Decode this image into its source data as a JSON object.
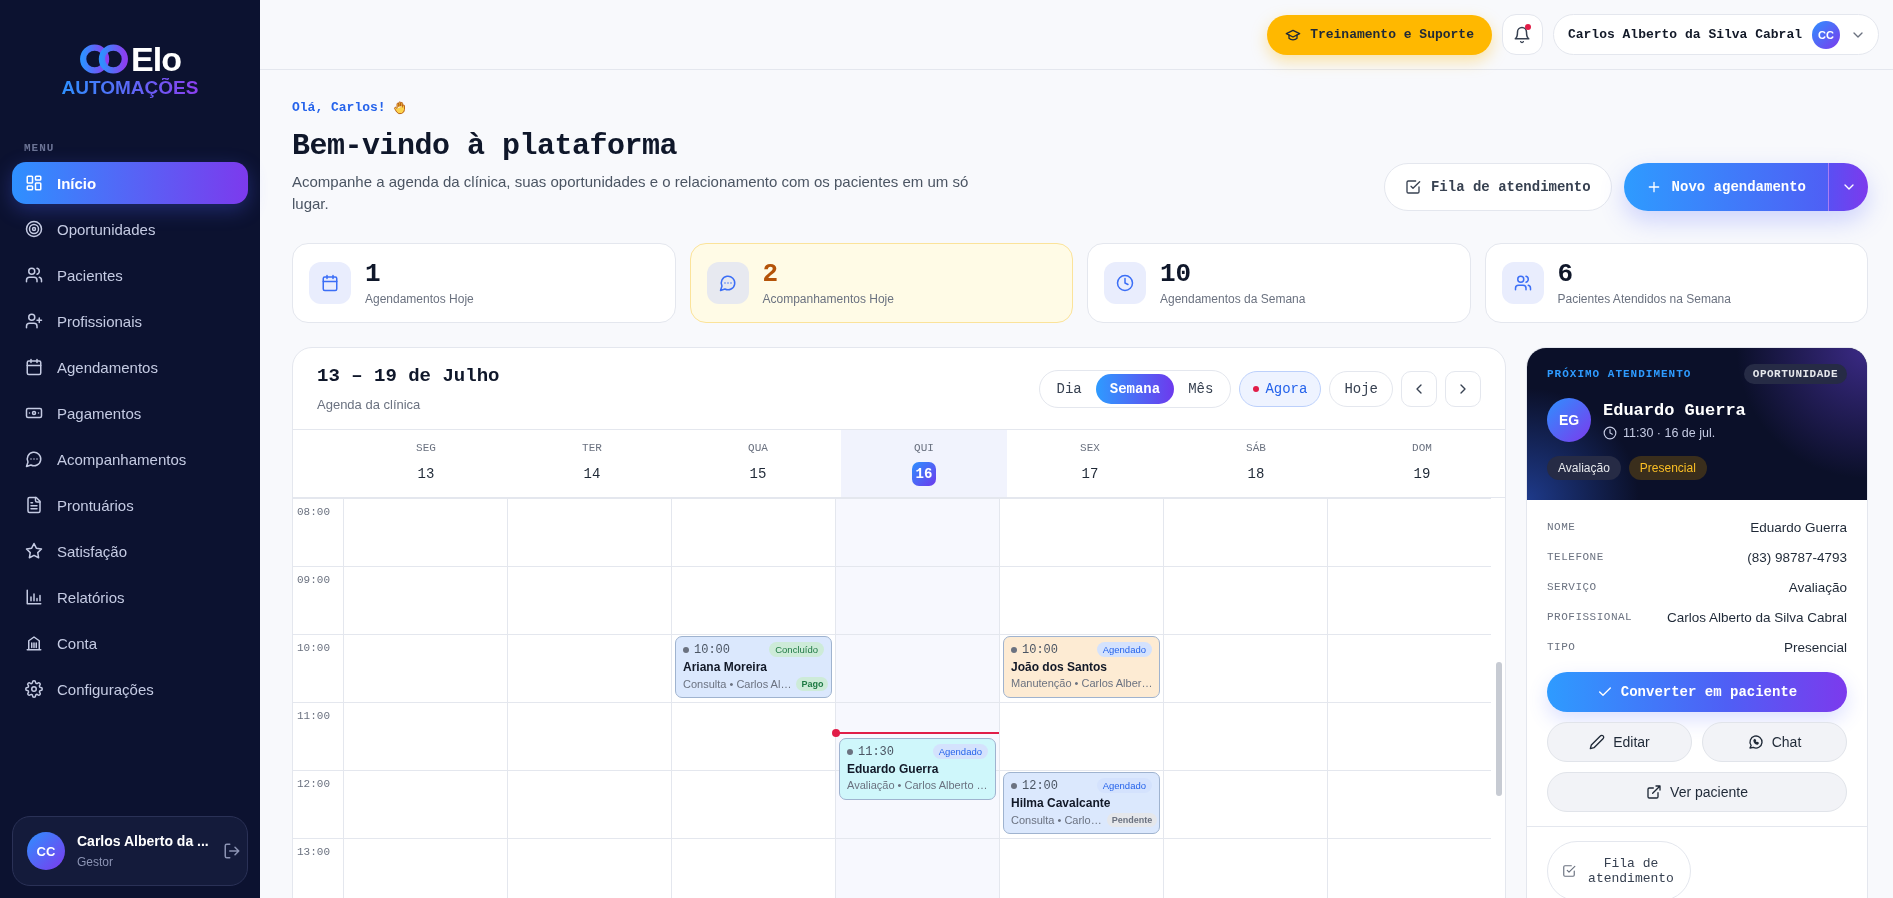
{
  "sidebar": {
    "logo": {
      "name": "Elo",
      "tagline": "AUTOMAÇÕES"
    },
    "menu_label": "MENU",
    "items": [
      {
        "label": "Início",
        "selected": true
      },
      {
        "label": "Oportunidades",
        "selected": false
      },
      {
        "label": "Pacientes",
        "selected": false
      },
      {
        "label": "Profissionais",
        "selected": false
      },
      {
        "label": "Agendamentos",
        "selected": false
      },
      {
        "label": "Pagamentos",
        "selected": false
      },
      {
        "label": "Acompanhamentos",
        "selected": false
      },
      {
        "label": "Prontuários",
        "selected": false
      },
      {
        "label": "Satisfação",
        "selected": false
      },
      {
        "label": "Relatórios",
        "selected": false
      },
      {
        "label": "Conta",
        "selected": false
      },
      {
        "label": "Configurações",
        "selected": false
      }
    ],
    "user": {
      "initials": "CC",
      "name": "Carlos Alberto da ...",
      "role": "Gestor"
    }
  },
  "header": {
    "support_button": "Treinamento e Suporte",
    "notifications": {
      "unread": true
    },
    "user": {
      "name": "Carlos Alberto da Silva Cabral",
      "initials": "CC"
    }
  },
  "welcome": {
    "greeting": "Olá, Carlos!",
    "title": "Bem-vindo à plataforma",
    "subtitle": "Acompanhe a agenda da clínica, suas oportunidades e o relacionamento com os pacientes em um só lugar.",
    "queue_button": "Fila de atendimento",
    "new_button": "Novo agendamento"
  },
  "stats": [
    {
      "value": "1",
      "label": "Agendamentos Hoje",
      "highlighted": false
    },
    {
      "value": "2",
      "label": "Acompanhamentos Hoje",
      "highlighted": true
    },
    {
      "value": "10",
      "label": "Agendamentos da Semana",
      "highlighted": false
    },
    {
      "value": "6",
      "label": "Pacientes Atendidos na Semana",
      "highlighted": false
    }
  ],
  "calendar": {
    "title": "13 – 19 de Julho",
    "subtitle": "Agenda da clínica",
    "views": [
      {
        "label": "Dia",
        "selected": false
      },
      {
        "label": "Semana",
        "selected": true
      },
      {
        "label": "Mês",
        "selected": false
      }
    ],
    "now_button": "Agora",
    "today_button": "Hoje",
    "hours": [
      "08:00",
      "09:00",
      "10:00",
      "11:00",
      "12:00",
      "13:00"
    ],
    "days": [
      {
        "name": "SEG",
        "date": "13",
        "today": false
      },
      {
        "name": "TER",
        "date": "14",
        "today": false
      },
      {
        "name": "QUA",
        "date": "15",
        "today": false,
        "events": [
          {
            "time": "10:00",
            "name": "Ariana Moreira",
            "detail": "Consulta • Carlos Al…",
            "color": "#dbe8fd",
            "status": {
              "label": "Concluído",
              "kind": "done"
            },
            "payment": {
              "label": "Pago",
              "kind": "paid"
            }
          }
        ]
      },
      {
        "name": "QUI",
        "date": "16",
        "today": true,
        "events": [
          {
            "time": "11:30",
            "name": "Eduardo Guerra",
            "detail": "Avaliação • Carlos Alberto …",
            "color": "#cff7fb",
            "status": {
              "label": "Agendado",
              "kind": "scheduled"
            }
          }
        ]
      },
      {
        "name": "SEX",
        "date": "17",
        "today": false,
        "events": [
          {
            "time": "10:00",
            "name": "João dos Santos",
            "detail": "Manutenção • Carlos Alber…",
            "color": "#fdebd3",
            "status": {
              "label": "Agendado",
              "kind": "scheduled"
            }
          },
          {
            "time": "12:00",
            "name": "Hilma Cavalcante",
            "detail": "Consulta • Carlo…",
            "color": "#dbe8fd",
            "status": {
              "label": "Agendado",
              "kind": "scheduled"
            },
            "payment": {
              "label": "Pendente",
              "kind": "pending"
            }
          }
        ]
      },
      {
        "name": "SÁB",
        "date": "18",
        "today": false
      },
      {
        "name": "DOM",
        "date": "19",
        "today": false
      }
    ]
  },
  "next_appointment": {
    "heading": "PRÓXIMO ATENDIMENTO",
    "badge": "OPORTUNIDADE",
    "initials": "EG",
    "name": "Eduardo Guerra",
    "when": "11:30 · 16 de jul.",
    "tags": [
      {
        "label": "Avaliação",
        "kind": "neutral"
      },
      {
        "label": "Presencial",
        "kind": "accent"
      }
    ],
    "details": [
      {
        "label": "NOME",
        "value": "Eduardo Guerra"
      },
      {
        "label": "TELEFONE",
        "value": "(83) 98787-4793"
      },
      {
        "label": "SERVIÇO",
        "value": "Avaliação"
      },
      {
        "label": "PROFISSIONAL",
        "value": "Carlos Alberto da Silva Cabral"
      },
      {
        "label": "TIPO",
        "value": "Presencial"
      }
    ],
    "convert_button": "Converter em paciente",
    "edit_button": "Editar",
    "chat_button": "Chat",
    "view_button": "Ver paciente",
    "queue_button": "Fila de atendimento"
  }
}
